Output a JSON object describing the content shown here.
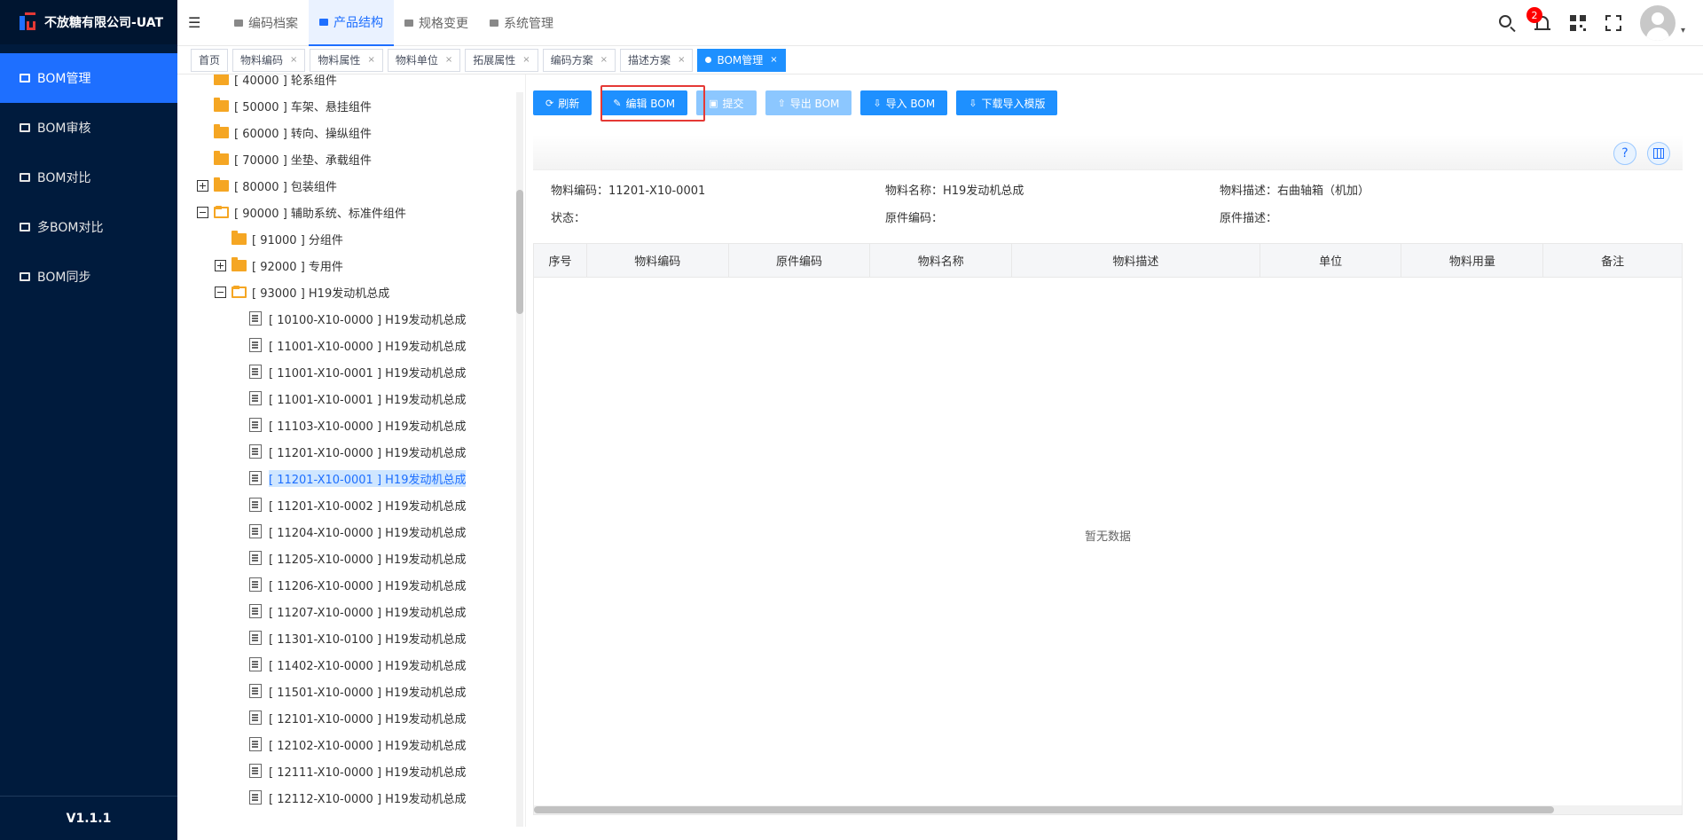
{
  "app": {
    "company": "不放糖有限公司-UAT",
    "version": "V1.1.1"
  },
  "sidebar": {
    "items": [
      {
        "label": "BOM管理",
        "active": true
      },
      {
        "label": "BOM审核"
      },
      {
        "label": "BOM对比"
      },
      {
        "label": "多BOM对比"
      },
      {
        "label": "BOM同步"
      }
    ]
  },
  "header": {
    "nav": [
      {
        "label": "编码档案"
      },
      {
        "label": "产品结构",
        "active": true
      },
      {
        "label": "规格变更"
      },
      {
        "label": "系统管理"
      }
    ],
    "notification_count": "2",
    "collapse_glyph": "☰",
    "caret": "▾"
  },
  "tabs": [
    {
      "label": "首页"
    },
    {
      "label": "物料编码"
    },
    {
      "label": "物料属性"
    },
    {
      "label": "物料单位"
    },
    {
      "label": "拓展属性"
    },
    {
      "label": "编码方案"
    },
    {
      "label": "描述方案"
    },
    {
      "label": "BOM管理",
      "active": true
    }
  ],
  "toolbar": {
    "refresh": "刷新",
    "edit_bom": "编辑 BOM",
    "submit": "提交",
    "export_bom": "导出 BOM",
    "import_bom": "导入 BOM",
    "download_template": "下载导入模版"
  },
  "tree": [
    {
      "label": "[ 40000 ] 轮系组件",
      "type": "folder",
      "level": 1
    },
    {
      "label": "[ 50000 ] 车架、悬挂组件",
      "type": "folder",
      "level": 1
    },
    {
      "label": "[ 60000 ] 转向、操纵组件",
      "type": "folder",
      "level": 1
    },
    {
      "label": "[ 70000 ] 坐垫、承载组件",
      "type": "folder",
      "level": 1
    },
    {
      "label": "[ 80000 ] 包装组件",
      "type": "folder",
      "level": 1,
      "expander": "plus"
    },
    {
      "label": "[ 90000 ] 辅助系统、标准件组件",
      "type": "folder-open",
      "level": 1,
      "expander": "minus"
    },
    {
      "label": "[ 91000 ] 分组件",
      "type": "folder",
      "level": 2
    },
    {
      "label": "[ 92000 ] 专用件",
      "type": "folder",
      "level": 2,
      "expander": "plus"
    },
    {
      "label": "[ 93000 ] H19发动机总成",
      "type": "folder-open",
      "level": 2,
      "expander": "minus"
    },
    {
      "label": "[ 10100-X10-0000 ] H19发动机总成",
      "type": "file",
      "level": 3
    },
    {
      "label": "[ 11001-X10-0000 ] H19发动机总成",
      "type": "file",
      "level": 3
    },
    {
      "label": "[ 11001-X10-0001 ] H19发动机总成",
      "type": "file",
      "level": 3
    },
    {
      "label": "[ 11001-X10-0001 ] H19发动机总成",
      "type": "file",
      "level": 3
    },
    {
      "label": "[ 11103-X10-0000 ] H19发动机总成",
      "type": "file",
      "level": 3
    },
    {
      "label": "[ 11201-X10-0000 ] H19发动机总成",
      "type": "file",
      "level": 3
    },
    {
      "label": "[ 11201-X10-0001 ] H19发动机总成",
      "type": "file",
      "level": 3,
      "selected": true
    },
    {
      "label": "[ 11201-X10-0002 ] H19发动机总成",
      "type": "file",
      "level": 3
    },
    {
      "label": "[ 11204-X10-0000 ] H19发动机总成",
      "type": "file",
      "level": 3
    },
    {
      "label": "[ 11205-X10-0000 ] H19发动机总成",
      "type": "file",
      "level": 3
    },
    {
      "label": "[ 11206-X10-0000 ] H19发动机总成",
      "type": "file",
      "level": 3
    },
    {
      "label": "[ 11207-X10-0000 ] H19发动机总成",
      "type": "file",
      "level": 3
    },
    {
      "label": "[ 11301-X10-0100 ] H19发动机总成",
      "type": "file",
      "level": 3
    },
    {
      "label": "[ 11402-X10-0000 ] H19发动机总成",
      "type": "file",
      "level": 3
    },
    {
      "label": "[ 11501-X10-0000 ] H19发动机总成",
      "type": "file",
      "level": 3
    },
    {
      "label": "[ 12101-X10-0000 ] H19发动机总成",
      "type": "file",
      "level": 3
    },
    {
      "label": "[ 12102-X10-0000 ] H19发动机总成",
      "type": "file",
      "level": 3
    },
    {
      "label": "[ 12111-X10-0000 ] H19发动机总成",
      "type": "file",
      "level": 3
    },
    {
      "label": "[ 12112-X10-0000 ] H19发动机总成",
      "type": "file",
      "level": 3
    }
  ],
  "details": {
    "material_code": "物料编码：11201-X10-0001",
    "material_name": "物料名称：H19发动机总成",
    "material_desc": "物料描述：右曲轴箱（机加）",
    "status": "状态：",
    "original_code": "原件编码：",
    "original_desc": "原件描述："
  },
  "table": {
    "columns": [
      "序号",
      "物料编码",
      "原件编码",
      "物料名称",
      "物料描述",
      "单位",
      "物料用量",
      "备注"
    ],
    "empty_text": "暂无数据"
  },
  "icons": {
    "help": "?"
  },
  "colors": {
    "primary": "#1e90ff",
    "sidebar": "#001b3d",
    "highlight": "#e53935"
  }
}
